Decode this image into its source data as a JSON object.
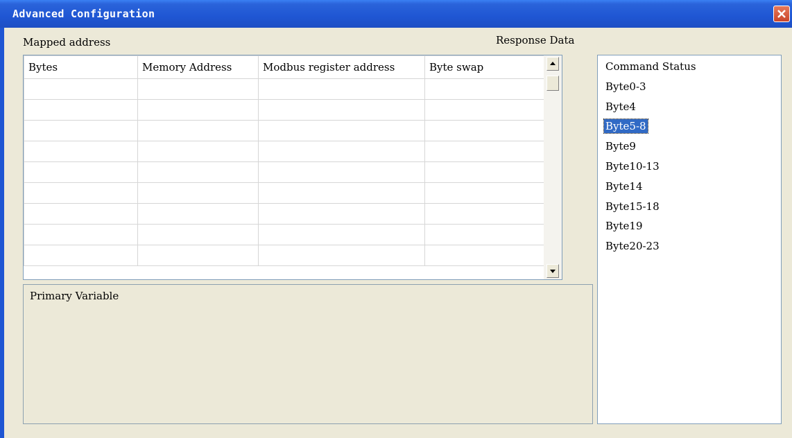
{
  "window": {
    "title": "Advanced Configuration"
  },
  "labels": {
    "mapped_address": "Mapped address",
    "response_data": "Response Data",
    "primary_variable": "Primary Variable"
  },
  "table": {
    "columns": [
      "Bytes",
      "Memory Address",
      "Modbus register address",
      "Byte swap"
    ],
    "rows": [
      [
        "",
        "",
        "",
        ""
      ],
      [
        "",
        "",
        "",
        ""
      ],
      [
        "",
        "",
        "",
        ""
      ],
      [
        "",
        "",
        "",
        ""
      ],
      [
        "",
        "",
        "",
        ""
      ],
      [
        "",
        "",
        "",
        ""
      ],
      [
        "",
        "",
        "",
        ""
      ],
      [
        "",
        "",
        "",
        ""
      ],
      [
        "",
        "",
        "",
        ""
      ]
    ]
  },
  "response_list": {
    "items": [
      "Command Status",
      "Byte0-3",
      "Byte4",
      "Byte5-8",
      "Byte9",
      "Byte10-13",
      "Byte14",
      "Byte15-18",
      "Byte19",
      "Byte20-23"
    ],
    "selected": "Byte5-8"
  },
  "icons": {
    "close": "close-icon",
    "scroll_up": "scroll-up-arrow-icon",
    "scroll_down": "scroll-down-arrow-icon"
  },
  "colors": {
    "titlebar": "#1F56D3",
    "selection": "#316AC5",
    "close_button": "#D9583B",
    "window_bg": "#ECE9D8"
  }
}
